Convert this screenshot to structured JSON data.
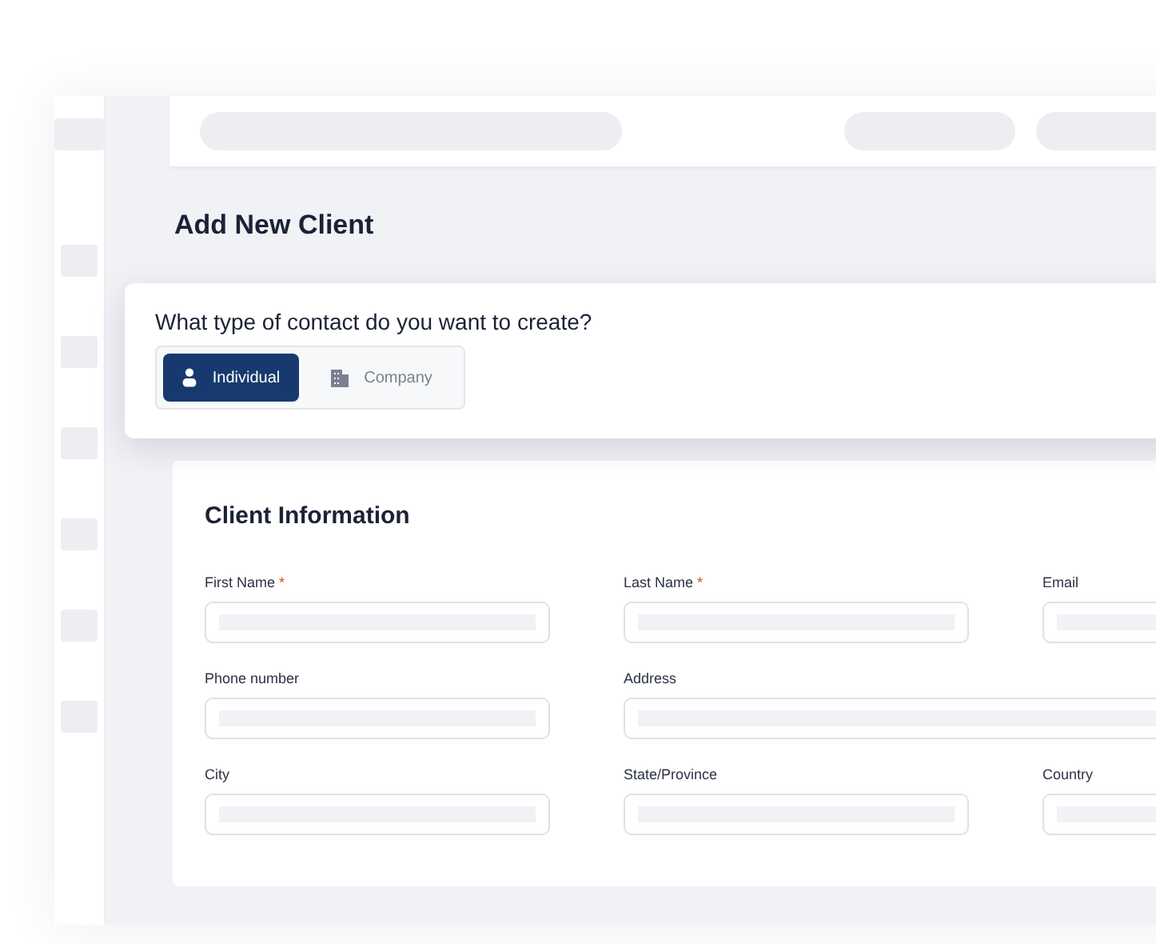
{
  "page_title": "Add New Client",
  "contact_type": {
    "question": "What type of contact do you want to create?",
    "options": [
      {
        "label": "Individual",
        "kind": "person",
        "selected": true
      },
      {
        "label": "Company",
        "kind": "building",
        "selected": false
      }
    ]
  },
  "form": {
    "title": "Client Information",
    "fields": [
      {
        "label": "First Name",
        "required_mark": "*",
        "wide": false
      },
      {
        "label": "Last Name",
        "required_mark": "*",
        "wide": false
      },
      {
        "label": "Email",
        "wide": false
      },
      {
        "label": "Phone number",
        "wide": false
      },
      {
        "label": "Address",
        "wide": true
      },
      {
        "label": "City",
        "wide": false
      },
      {
        "label": "State/Province",
        "wide": false
      },
      {
        "label": "Country",
        "wide": false
      }
    ]
  }
}
